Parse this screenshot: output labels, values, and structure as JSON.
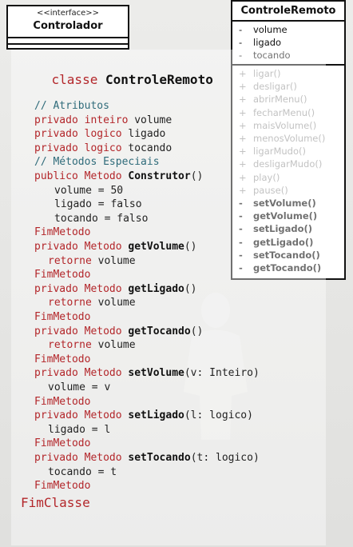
{
  "interface_box": {
    "stereotype": "<<interface>>",
    "name": "Controlador"
  },
  "class_box": {
    "name": "ControleRemoto",
    "attributes": [
      {
        "visibility": "-",
        "name": "volume"
      },
      {
        "visibility": "-",
        "name": "ligado"
      },
      {
        "visibility": "-",
        "name": "tocando"
      }
    ],
    "operations": [
      {
        "visibility": "+",
        "name": "ligar()",
        "faded": true
      },
      {
        "visibility": "+",
        "name": "desligar()",
        "faded": true
      },
      {
        "visibility": "+",
        "name": "abrirMenu()",
        "faded": true
      },
      {
        "visibility": "+",
        "name": "fecharMenu()",
        "faded": true
      },
      {
        "visibility": "+",
        "name": "maisVolume()",
        "faded": true
      },
      {
        "visibility": "+",
        "name": "menosVolume()",
        "faded": true
      },
      {
        "visibility": "+",
        "name": "ligarMudo()",
        "faded": true
      },
      {
        "visibility": "+",
        "name": "desligarMudo()",
        "faded": true
      },
      {
        "visibility": "+",
        "name": "play()",
        "faded": true
      },
      {
        "visibility": "+",
        "name": "pause()",
        "faded": true
      },
      {
        "visibility": "-",
        "name": "setVolume()",
        "faded": false
      },
      {
        "visibility": "-",
        "name": "getVolume()",
        "faded": false
      },
      {
        "visibility": "-",
        "name": "setLigado()",
        "faded": false
      },
      {
        "visibility": "-",
        "name": "getLigado()",
        "faded": false
      },
      {
        "visibility": "-",
        "name": "setTocando()",
        "faded": false
      },
      {
        "visibility": "-",
        "name": "getTocando()",
        "faded": false
      }
    ]
  },
  "code": {
    "class_header": {
      "keyword": "classe",
      "name": "ControleRemoto"
    },
    "lines": [
      [
        {
          "t": "// Atributos",
          "c": "cm"
        }
      ],
      [
        {
          "t": "privado inteiro ",
          "c": "kw"
        },
        {
          "t": "volume",
          "c": "tx"
        }
      ],
      [
        {
          "t": "privado logico ",
          "c": "kw"
        },
        {
          "t": "ligado",
          "c": "tx"
        }
      ],
      [
        {
          "t": "privado logico ",
          "c": "kw"
        },
        {
          "t": "tocando",
          "c": "tx"
        }
      ],
      [
        {
          "t": "// Métodos Especiais",
          "c": "cm"
        }
      ],
      [
        {
          "t": "publico Metodo ",
          "c": "kw"
        },
        {
          "t": "Construtor",
          "c": "fn"
        },
        {
          "t": "()",
          "c": "tx"
        }
      ],
      [
        {
          "t": "volume = 50",
          "c": "tx"
        }
      ],
      [
        {
          "t": "ligado = falso",
          "c": "tx"
        }
      ],
      [
        {
          "t": "tocando = falso",
          "c": "tx"
        }
      ],
      [
        {
          "t": "FimMetodo",
          "c": "kw"
        }
      ],
      [
        {
          "t": "privado Metodo ",
          "c": "kw"
        },
        {
          "t": "getVolume",
          "c": "fn"
        },
        {
          "t": "()",
          "c": "tx"
        }
      ],
      [
        {
          "t": "retorne ",
          "c": "kw"
        },
        {
          "t": "volume",
          "c": "tx"
        }
      ],
      [
        {
          "t": "FimMetodo",
          "c": "kw"
        }
      ],
      [
        {
          "t": "privado Metodo ",
          "c": "kw"
        },
        {
          "t": "getLigado",
          "c": "fn"
        },
        {
          "t": "()",
          "c": "tx"
        }
      ],
      [
        {
          "t": "retorne ",
          "c": "kw"
        },
        {
          "t": "volume",
          "c": "tx"
        }
      ],
      [
        {
          "t": "FimMetodo",
          "c": "kw"
        }
      ],
      [
        {
          "t": "privado Metodo ",
          "c": "kw"
        },
        {
          "t": "getTocando",
          "c": "fn"
        },
        {
          "t": "()",
          "c": "tx"
        }
      ],
      [
        {
          "t": "retorne ",
          "c": "kw"
        },
        {
          "t": "volume",
          "c": "tx"
        }
      ],
      [
        {
          "t": "FimMetodo",
          "c": "kw"
        }
      ],
      [
        {
          "t": "privado Metodo ",
          "c": "kw"
        },
        {
          "t": "setVolume",
          "c": "fn"
        },
        {
          "t": "(v: Inteiro)",
          "c": "tx"
        }
      ],
      [
        {
          "t": "volume = v",
          "c": "tx"
        }
      ],
      [
        {
          "t": "FimMetodo",
          "c": "kw"
        }
      ],
      [
        {
          "t": "privado Metodo ",
          "c": "kw"
        },
        {
          "t": "setLigado",
          "c": "fn"
        },
        {
          "t": "(l: logico)",
          "c": "tx"
        }
      ],
      [
        {
          "t": "ligado = l",
          "c": "tx"
        }
      ],
      [
        {
          "t": "FimMetodo",
          "c": "kw"
        }
      ],
      [
        {
          "t": "privado Metodo ",
          "c": "kw"
        },
        {
          "t": "setTocando",
          "c": "fn"
        },
        {
          "t": "(t: logico)",
          "c": "tx"
        }
      ],
      [
        {
          "t": "tocando = t",
          "c": "tx"
        }
      ],
      [
        {
          "t": "FimMetodo",
          "c": "kw"
        }
      ]
    ],
    "footer": "FimClasse"
  },
  "colors": {
    "keyword": "#b3262a",
    "comment": "#2f6b7a",
    "text": "#222222",
    "faded_operation": "#9a9a9a"
  }
}
